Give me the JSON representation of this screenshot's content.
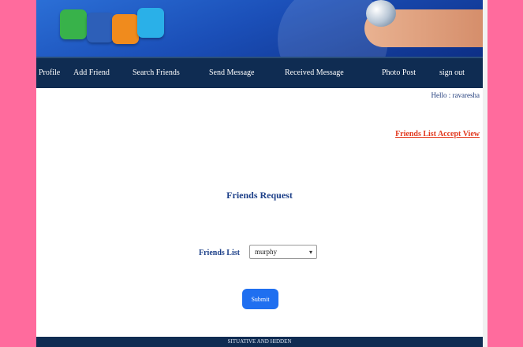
{
  "nav": {
    "items": [
      "Profile",
      "Add Friend",
      "Search Friends",
      "Send Message",
      "Received Message",
      "Photo Post",
      "sign out"
    ]
  },
  "header": {
    "hello": "Hello : ravaresha"
  },
  "sublink": "Friends List Accept View",
  "form": {
    "title": "Friends Request",
    "field_label": "Friends List",
    "selected": "murphy",
    "submit_label": "Submit"
  },
  "footer": "SITUATIVE AND HIDDEN"
}
